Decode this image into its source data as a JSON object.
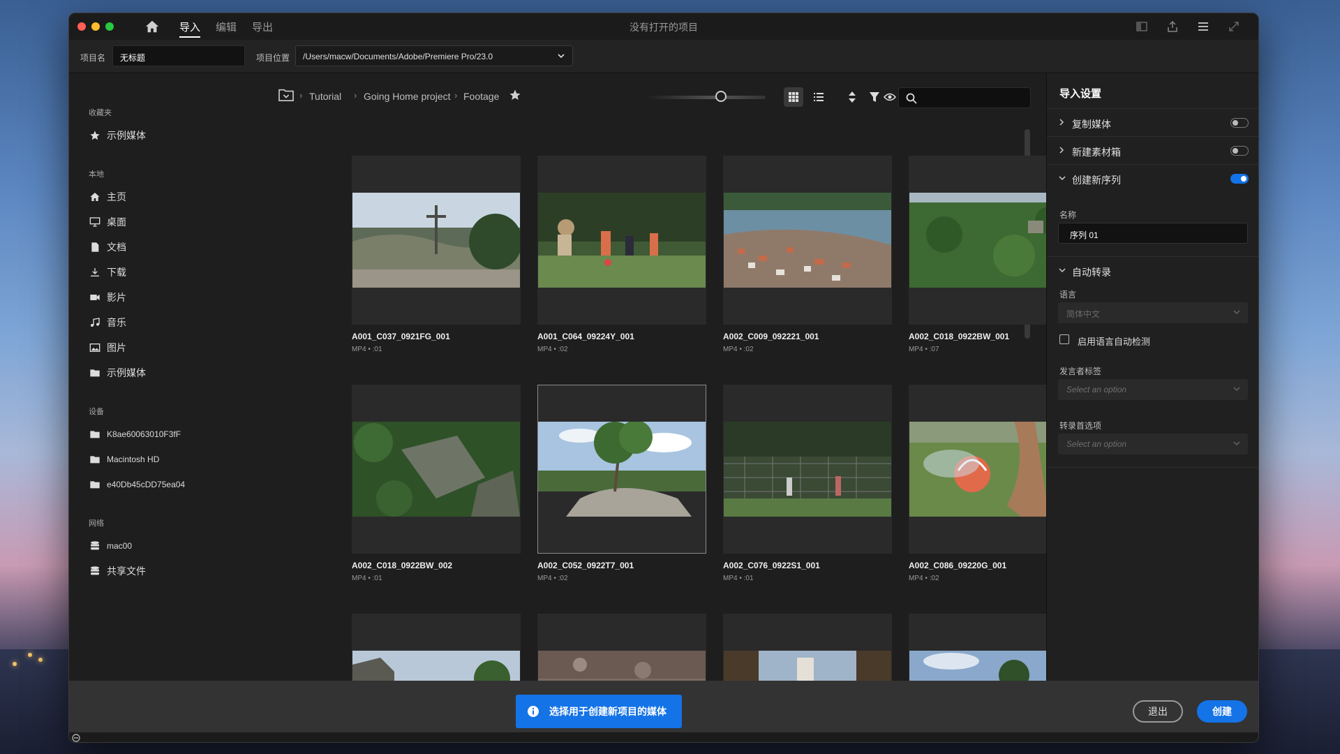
{
  "titlebar": {
    "tabs": [
      "导入",
      "编辑",
      "导出"
    ],
    "active_tab": "导入",
    "window_title": "没有打开的项目"
  },
  "projectbar": {
    "name_label": "项目名",
    "name_value": "无标题",
    "location_label": "项目位置",
    "location_value": "/Users/macw/Documents/Adobe/Premiere Pro/23.0"
  },
  "sidebar": {
    "favorites_label": "收藏夹",
    "favorites": [
      {
        "label": "示例媒体",
        "icon": "star-icon"
      }
    ],
    "local_label": "本地",
    "local": [
      {
        "label": "主页",
        "icon": "home-icon"
      },
      {
        "label": "桌面",
        "icon": "monitor-icon"
      },
      {
        "label": "文档",
        "icon": "document-icon"
      },
      {
        "label": "下载",
        "icon": "download-icon"
      },
      {
        "label": "影片",
        "icon": "video-icon"
      },
      {
        "label": "音乐",
        "icon": "music-icon"
      },
      {
        "label": "图片",
        "icon": "image-icon"
      },
      {
        "label": "示例媒体",
        "icon": "folder-icon"
      }
    ],
    "devices_label": "设备",
    "devices": [
      {
        "label": "K8ae60063010F3fF",
        "icon": "folder-icon"
      },
      {
        "label": "Macintosh HD",
        "icon": "folder-icon"
      },
      {
        "label": "e40Db45cDD75ea04",
        "icon": "folder-icon"
      }
    ],
    "network_label": "网络",
    "network": [
      {
        "label": "mac00",
        "icon": "server-icon"
      },
      {
        "label": "共享文件",
        "icon": "server-icon"
      }
    ]
  },
  "breadcrumb": [
    "Tutorial",
    "Going Home project",
    "Footage"
  ],
  "zoom": 0.5,
  "files": [
    {
      "name": "A001_C037_0921FG_001",
      "meta": "MP4 • :01",
      "selected": false
    },
    {
      "name": "A001_C064_09224Y_001",
      "meta": "MP4 • :02",
      "selected": false
    },
    {
      "name": "A002_C009_092221_001",
      "meta": "MP4 • :02",
      "selected": false
    },
    {
      "name": "A002_C018_0922BW_001",
      "meta": "MP4 • :07",
      "selected": false
    },
    {
      "name": "A002_C018_0922BW_002",
      "meta": "MP4 • :01",
      "selected": false
    },
    {
      "name": "A002_C052_0922T7_001",
      "meta": "MP4 • :02",
      "selected": true
    },
    {
      "name": "A002_C076_0922S1_001",
      "meta": "MP4 • :01",
      "selected": false
    },
    {
      "name": "A002_C086_09220G_001",
      "meta": "MP4 • :02",
      "selected": false
    }
  ],
  "import_settings": {
    "title": "导入设置",
    "copy_media": {
      "label": "复制媒体",
      "enabled": false
    },
    "new_bin": {
      "label": "新建素材箱",
      "enabled": false
    },
    "new_sequence": {
      "label": "创建新序列",
      "enabled": true
    },
    "name_label": "名称",
    "name_value": "序列 01",
    "auto_transcribe": {
      "label": "自动转录"
    },
    "language_label": "语言",
    "language_value": "简体中文",
    "auto_detect_label": "启用语言自动检测",
    "speaker_label": "发言者标签",
    "speaker_value": "Select an option",
    "transcribe_pref_label": "转录首选项",
    "transcribe_pref_value": "Select an option"
  },
  "bottombar": {
    "info_text": "选择用于创建新项目的媒体",
    "exit_label": "退出",
    "create_label": "创建"
  },
  "colors": {
    "accent": "#1473e6",
    "panel": "#1e1e1e",
    "bottom": "#333333"
  }
}
